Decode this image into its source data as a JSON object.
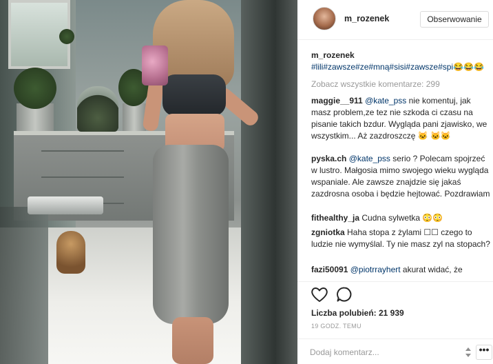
{
  "post": {
    "username": "m_rozenek",
    "follow_label": "Obserwowanie"
  },
  "caption": {
    "user": "m_rozenek",
    "text": "#lili#zawsze#ze#mną#sisi#zawsze#spi😂😂😂"
  },
  "view_all": "Zobacz wszystkie komentarze: 299",
  "comments": [
    {
      "user": "maggie__911",
      "mention": "@kate_pss",
      "text": " nie komentuj, jak masz problem,ze tez nie szkoda ci czasu na pisanie takich bzdur. Wygląda pani zjawisko, we wszystkim... Aż zazdroszczę 🐱 🐱🐱"
    },
    {
      "user": "pyska.ch",
      "mention": "@kate_pss",
      "text": " serio ? Polecam spojrzeć w lustro. Małgosia mimo swojego wieku wygląda wspaniale. Ale zawsze znajdzie się jakaś zazdrosna osoba i będzie hejtować. Pozdrawiam"
    },
    {
      "user": "fithealthy_ja",
      "mention": "",
      "text": "Cudna sylwetka 😳😳"
    },
    {
      "user": "zgniotka",
      "mention": "",
      "text": "Haha stopa z żylami ☐☐ czego to ludzie nie wymyślal. Ty nie masz zyl na stopach?"
    },
    {
      "user": "fazi50091",
      "mention": "@piotrrayhert",
      "text": " akurat widać, że"
    }
  ],
  "likes_label": "Liczba polubień: 21 939",
  "time_label": "19 GODZ. TEMU",
  "add_comment_placeholder": "Dodaj komentarz...",
  "more_label": "•••",
  "colors": {
    "mention": "#003569",
    "muted": "#999999",
    "border": "#efefef"
  },
  "icons": [
    "heart-icon",
    "comment-icon",
    "more-options-icon",
    "loading-spinner-icon"
  ]
}
